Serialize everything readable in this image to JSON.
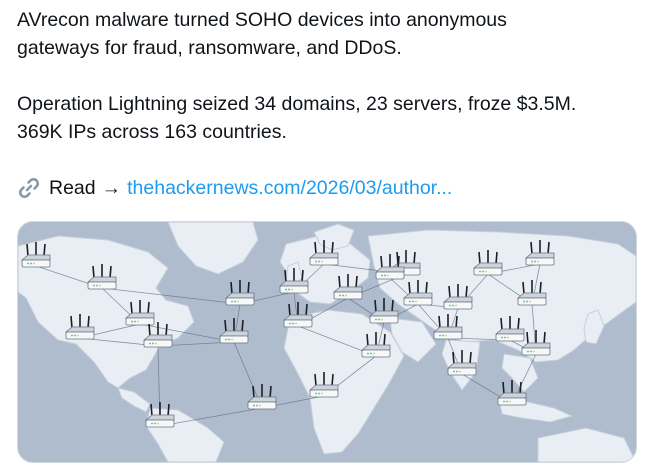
{
  "tweet": {
    "line1": "AVrecon malware turned SOHO devices into anonymous",
    "line2": "gateways for fraud, ransomware, and DDoS.",
    "line3": "Operation Lightning seized 34 domains, 23 servers, froze $3.5M.",
    "line4": "369K IPs across 163 countries.",
    "read_label": "Read",
    "arrow": "→",
    "link_text": "thehackernews.com/2026/03/author..."
  },
  "icons": {
    "link": "link-icon",
    "router": "router-icon"
  },
  "colors": {
    "link": "#1d9bf0",
    "ocean": "#aebccd",
    "land": "#e9eef4",
    "text": "#0f1419"
  }
}
